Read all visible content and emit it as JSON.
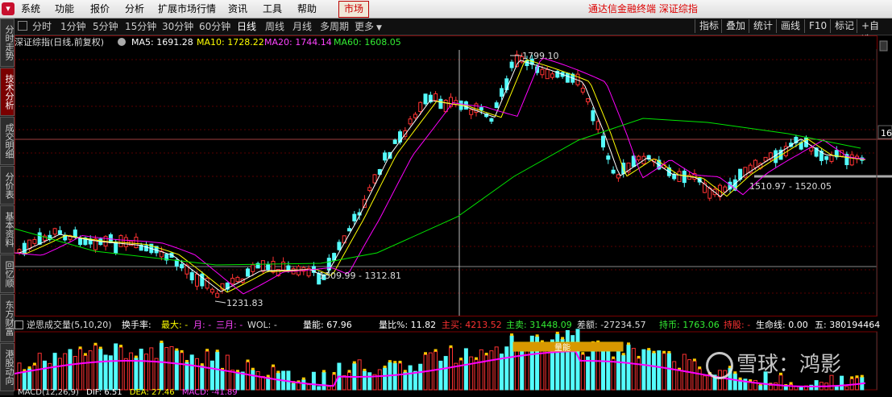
{
  "menu": {
    "items": [
      "系统",
      "功能",
      "报价",
      "分析",
      "扩展市场行情",
      "资讯",
      "工具",
      "帮助"
    ],
    "market_button": "市场",
    "app_title": "通达信金融终端  深证综指"
  },
  "side_tabs": [
    "分时走势",
    "技术分析",
    "成交明细",
    "分价表",
    "基本资料",
    "回忆顺",
    "东方财富",
    "港股动向"
  ],
  "toolbar": {
    "periods": [
      "分时",
      "1分钟",
      "5分钟",
      "15分钟",
      "30分钟",
      "60分钟",
      "日线",
      "周线",
      "月线",
      "多周期",
      "更多"
    ],
    "active_period": "日线",
    "buttons": [
      "指标",
      "叠加",
      "统计",
      "画线",
      "F10",
      "标记",
      "+自选"
    ]
  },
  "ma_header": {
    "title": "深证综指(日线,前复权)",
    "ma5": "MA5: 1691.28",
    "ma10": "MA10: 1728.22",
    "ma20": "MA20: 1744.14",
    "ma60": "MA60: 1608.05"
  },
  "annotations": {
    "high": "1799.10",
    "low": "1231.83",
    "range1": "1309.99 - 1312.81",
    "range2": "1510.97 - 1520.05",
    "right_marker": "16"
  },
  "volume_header": {
    "title": "逆思成交量(5,10,20)",
    "turnover": "换手率:",
    "max": "最大: -",
    "month": "月: -",
    "three_month": "三月: -",
    "wol": "WOL: -",
    "energy": "量能: 67.96",
    "ratio": "量比%: 11.82",
    "main_buy": "主买: 4213.52",
    "main_sell": "主卖: 31448.09",
    "diff": "差额: -27234.57",
    "hold": "持币: 1763.06",
    "hold_stock": "持股: -",
    "lifeline": "生命线: 0.00",
    "five": "五: 380194464"
  },
  "volume_label": "量能",
  "macd": {
    "title": "MACD(12,26,9)",
    "dif": "DIF: 6.51",
    "dea": "DEA: 27.46",
    "macd": "MACD: -41.89"
  },
  "watermark": "雪球：鸿影",
  "colors": {
    "up": "#ff3232",
    "down": "#54fcfc",
    "ma5": "#ffffff",
    "ma10": "#ffff00",
    "ma20": "#ff00ff",
    "ma60": "#00e600",
    "accent": "#c00000"
  }
}
